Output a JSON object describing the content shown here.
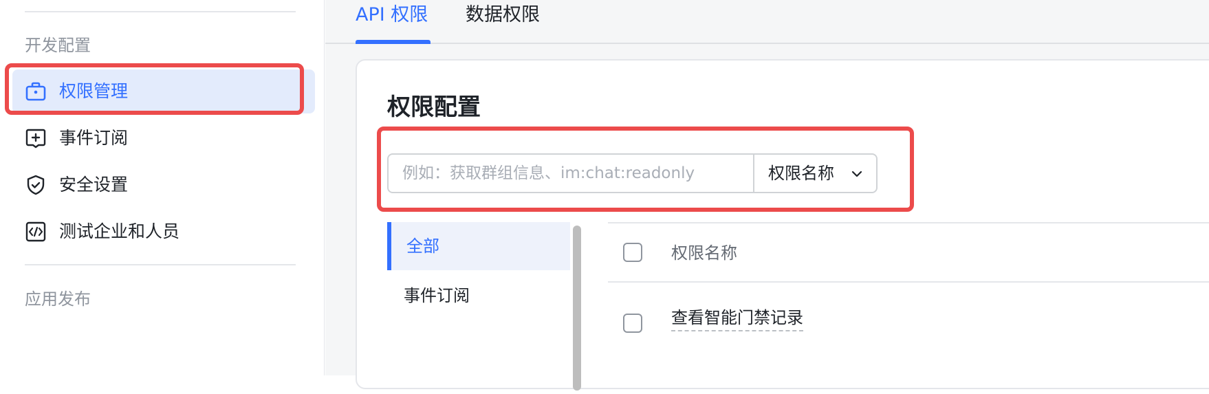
{
  "sidebar": {
    "section_dev": "开发配置",
    "items": [
      {
        "label": "权限管理",
        "icon": "briefcase-icon",
        "active": true
      },
      {
        "label": "事件订阅",
        "icon": "plus-box-icon",
        "active": false
      },
      {
        "label": "安全设置",
        "icon": "shield-check-icon",
        "active": false
      },
      {
        "label": "测试企业和人员",
        "icon": "code-box-icon",
        "active": false
      }
    ],
    "section_publish": "应用发布"
  },
  "tabs": [
    {
      "label": "API 权限",
      "active": true
    },
    {
      "label": "数据权限",
      "active": false
    }
  ],
  "card": {
    "title": "权限配置",
    "search": {
      "placeholder": "例如：获取群组信息、im:chat:readonly",
      "value": "",
      "select_label": "权限名称"
    },
    "categories": [
      {
        "label": "全部",
        "active": true
      },
      {
        "label": "事件订阅",
        "active": false
      }
    ],
    "table": {
      "header": "权限名称",
      "rows": [
        {
          "name": "查看智能门禁记录"
        }
      ]
    }
  },
  "colors": {
    "accent": "#3370ff",
    "highlight": "#ec4b4b",
    "active_bg": "#e3ebfc"
  }
}
